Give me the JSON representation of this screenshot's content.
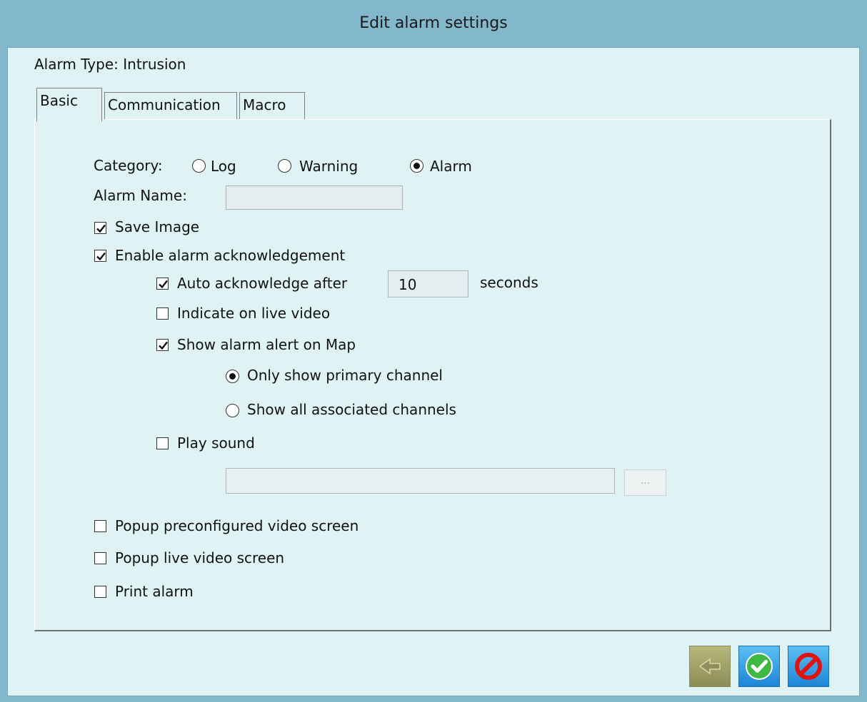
{
  "window": {
    "title": "Edit alarm settings"
  },
  "alarm_type_label": "Alarm Type: Intrusion",
  "tabs": [
    {
      "label": "Basic",
      "active": true
    },
    {
      "label": "Communication",
      "active": false
    },
    {
      "label": "Macro",
      "active": false
    }
  ],
  "basic": {
    "category_label": "Category:",
    "category_options": [
      {
        "label": "Log",
        "selected": false
      },
      {
        "label": "Warning",
        "selected": false
      },
      {
        "label": "Alarm",
        "selected": true
      }
    ],
    "alarm_name_label": "Alarm Name:",
    "alarm_name_value": "",
    "save_image": {
      "label": "Save Image",
      "checked": true
    },
    "enable_ack": {
      "label": "Enable alarm acknowledgement",
      "checked": true
    },
    "auto_ack": {
      "label": "Auto acknowledge after",
      "checked": true,
      "value": "10",
      "unit": "seconds"
    },
    "indicate_live": {
      "label": "Indicate on live video",
      "checked": false
    },
    "show_map": {
      "label": "Show alarm alert on Map",
      "checked": true
    },
    "map_options": [
      {
        "label": "Only show primary channel",
        "selected": true
      },
      {
        "label": "Show all associated channels",
        "selected": false
      }
    ],
    "play_sound": {
      "label": "Play sound",
      "checked": false
    },
    "sound_path": "",
    "browse_label": "...",
    "popup_preconfigured": {
      "label": "Popup preconfigured video screen",
      "checked": false
    },
    "popup_live": {
      "label": "Popup live video screen",
      "checked": false
    },
    "print_alarm": {
      "label": "Print alarm",
      "checked": false
    }
  },
  "footer_buttons": [
    {
      "name": "back",
      "icon": "back-arrow-icon",
      "enabled": false
    },
    {
      "name": "ok",
      "icon": "check-icon",
      "enabled": true
    },
    {
      "name": "cancel",
      "icon": "cancel-icon",
      "enabled": true
    }
  ],
  "colors": {
    "titlebar": "#83b8cc",
    "client": "#dff3f4",
    "ok_green": "#3fb944",
    "cancel_red": "#e01212",
    "button_blue": "#1e8fe0"
  }
}
